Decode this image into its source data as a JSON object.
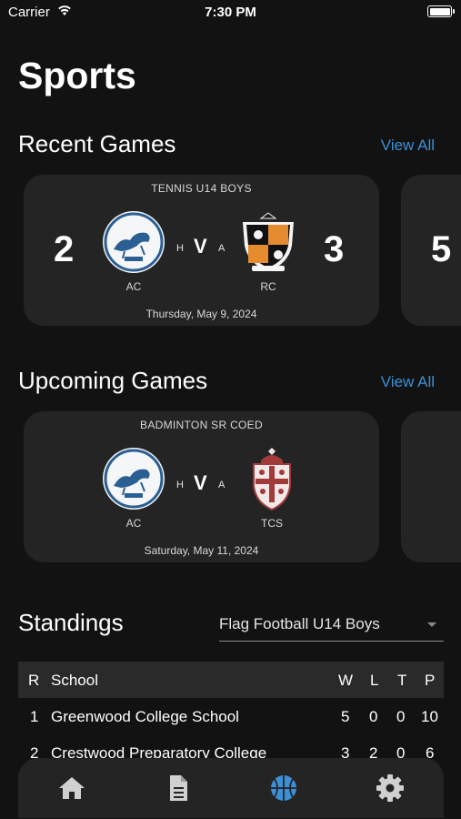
{
  "status_bar": {
    "carrier": "Carrier",
    "time": "7:30 PM"
  },
  "page_title": "Sports",
  "recent": {
    "title": "Recent Games",
    "view_all": "View All",
    "card": {
      "sport": "TENNIS U14 BOYS",
      "home_score": "2",
      "away_score": "3",
      "home_code": "AC",
      "away_code": "RC",
      "h": "H",
      "v": "V",
      "a": "A",
      "date": "Thursday, May 9, 2024"
    },
    "next_peek_score": "5"
  },
  "upcoming": {
    "title": "Upcoming Games",
    "view_all": "View All",
    "card": {
      "sport": "BADMINTON SR COED",
      "home_code": "AC",
      "away_code": "TCS",
      "h": "H",
      "v": "V",
      "a": "A",
      "date": "Saturday, May 11, 2024"
    }
  },
  "standings": {
    "title": "Standings",
    "selected_league": "Flag Football U14 Boys",
    "columns": {
      "rank": "R",
      "school": "School",
      "w": "W",
      "l": "L",
      "t": "T",
      "p": "P"
    },
    "rows": [
      {
        "rank": "1",
        "school": "Greenwood College School",
        "w": "5",
        "l": "0",
        "t": "0",
        "p": "10"
      },
      {
        "rank": "2",
        "school": "Crestwood Preparatory College",
        "w": "3",
        "l": "2",
        "t": "0",
        "p": "6"
      }
    ]
  },
  "tab_bar": {
    "tabs": [
      "home-icon",
      "document-icon",
      "basketball-icon",
      "gear-icon"
    ],
    "active_color": "#3d8fd6",
    "inactive_color": "#d0d0d0"
  }
}
